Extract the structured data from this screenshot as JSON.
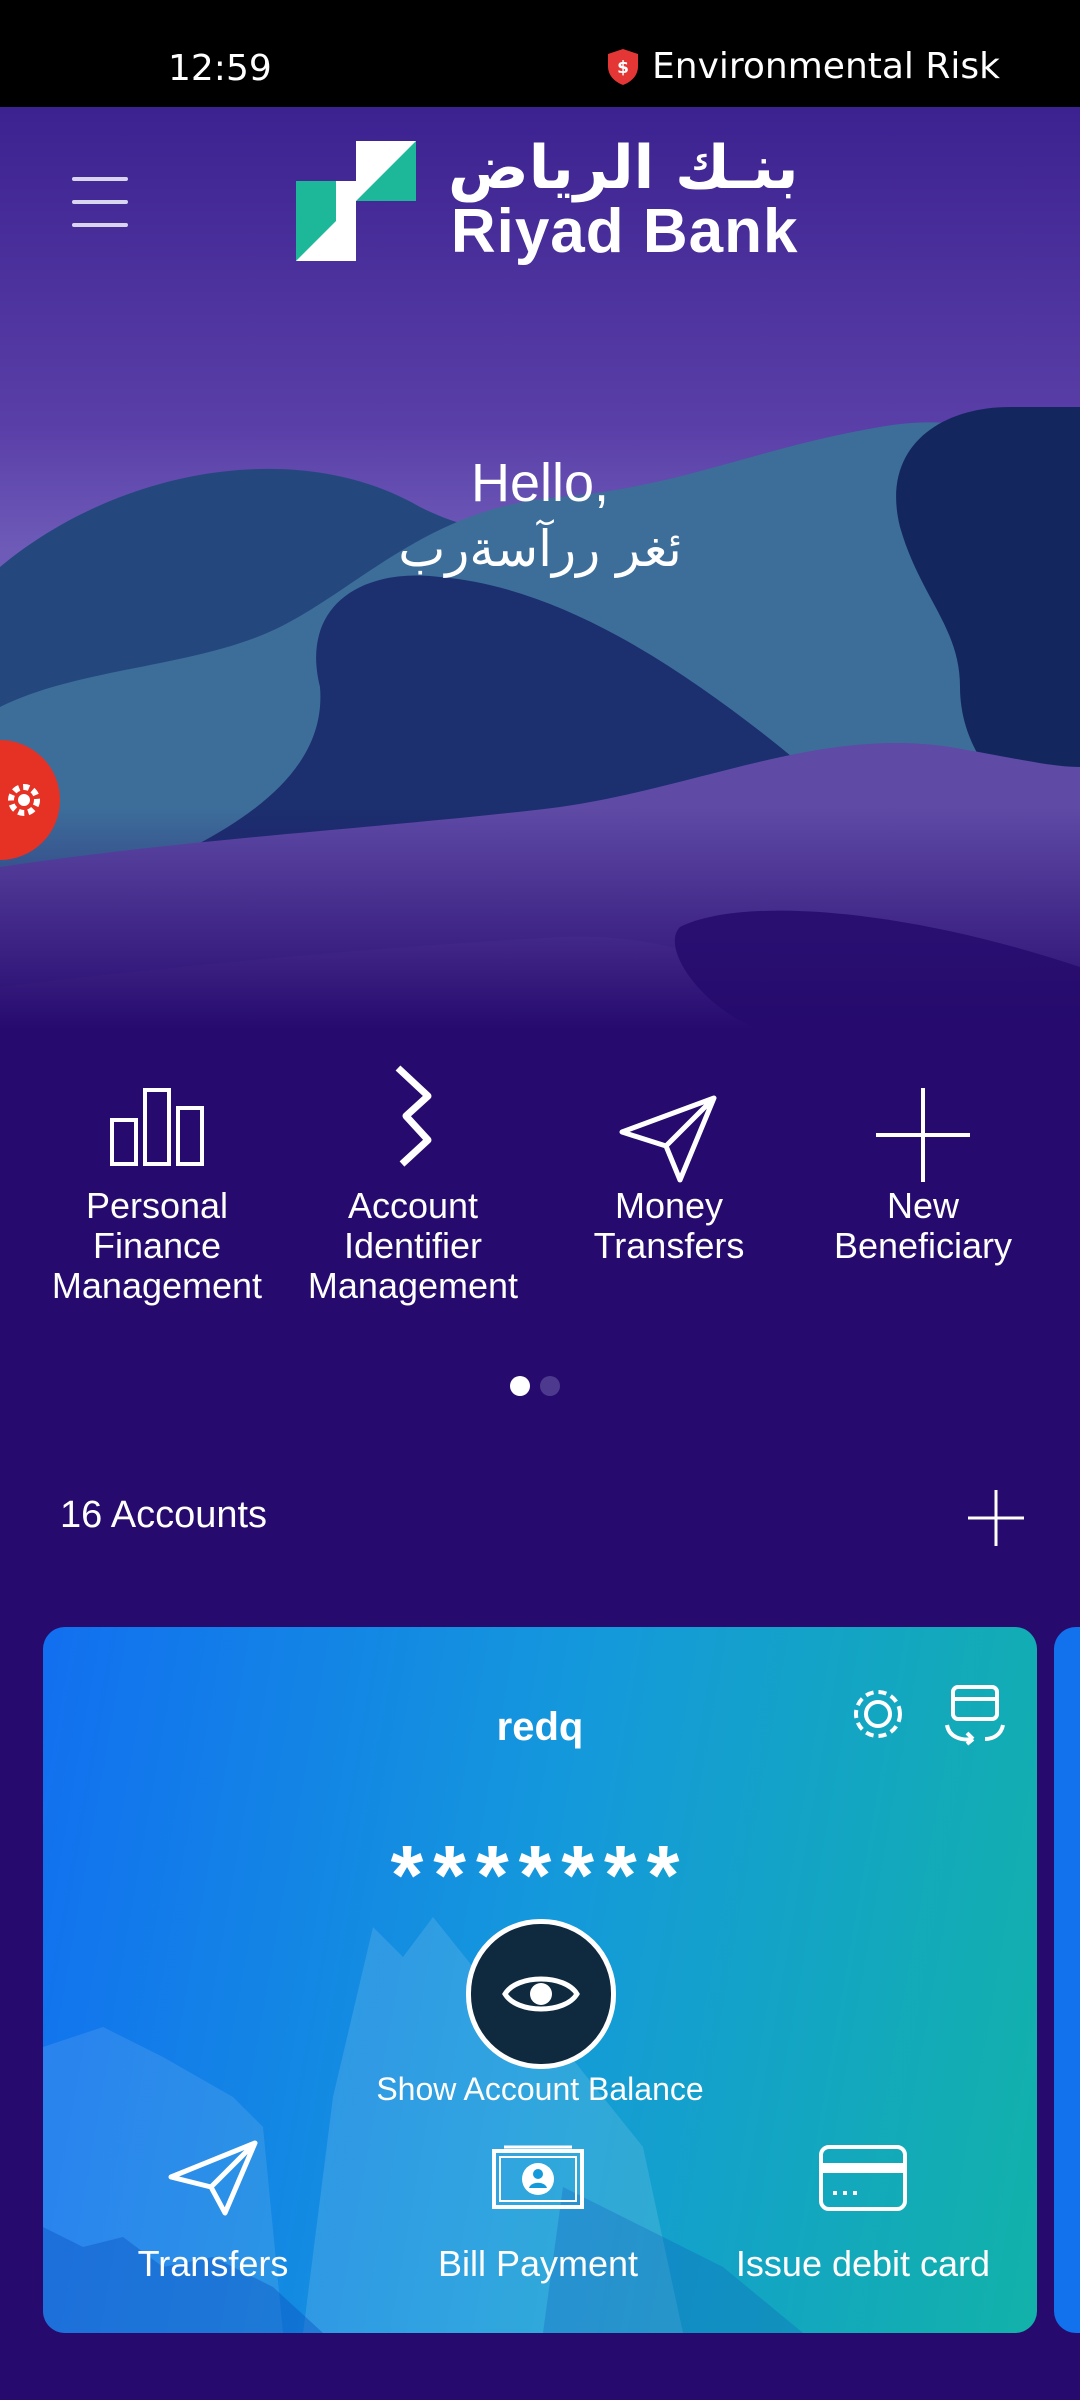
{
  "status_bar": {
    "time": "12:59",
    "alert": "Environmental Risk"
  },
  "header": {
    "logo_ar": "بنـك الرياض",
    "logo_en": "Riyad Bank"
  },
  "greeting": {
    "hello": "Hello,",
    "name": "ئغر ررآسةرب"
  },
  "quick_actions": [
    {
      "label": "Personal Finance Management",
      "icon": "bar-chart-icon"
    },
    {
      "label": "Account Identifier Management",
      "icon": "identifier-icon"
    },
    {
      "label": "Money Transfers",
      "icon": "paper-plane-icon"
    },
    {
      "label": "New Beneficiary",
      "icon": "plus-icon"
    }
  ],
  "pager": {
    "pages": 2,
    "active": 1
  },
  "accounts": {
    "count_label": "16 Accounts"
  },
  "card": {
    "name": "redq",
    "balance_mask": "*******",
    "show_balance_label": "Show Account Balance",
    "actions": [
      {
        "label": "Transfers",
        "icon": "paper-plane-icon"
      },
      {
        "label": "Bill Payment",
        "icon": "bill-icon"
      },
      {
        "label": "Issue debit card",
        "icon": "card-icon"
      }
    ]
  },
  "colors": {
    "background": "#260a6e",
    "status_bar": "#000000",
    "logo_green": "#1db89a",
    "settings_fab": "#e53224",
    "card_gradient_start": "#126ff0",
    "card_gradient_end": "#12b2a9"
  }
}
